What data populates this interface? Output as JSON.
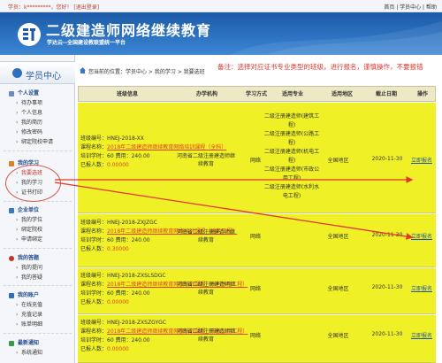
{
  "topbar": {
    "student_prefix": "学员：",
    "student_name": "k*********，您好！",
    "logout": "[退出登录]",
    "links": "首页 | 学员中心 | 帮助"
  },
  "banner": {
    "title": "二级建造师网络继续教育",
    "subtitle": "学达云--全国建设教联盟统一平台"
  },
  "sidebar": {
    "header": "学员中心",
    "groups": [
      {
        "title": "个人设置",
        "items": [
          "待办事项",
          "个人信息",
          "我的简历",
          "修改密码",
          "绑定院校申请"
        ]
      },
      {
        "title": "我的学习",
        "items": [
          "我要选班",
          "我的学习",
          "证书打印"
        ]
      },
      {
        "title": "企业单位",
        "items": [
          "我的学位",
          "绑定院校",
          "申请绑定"
        ]
      },
      {
        "title": "我的答题",
        "items": [
          "我的提问",
          "我的答疑"
        ]
      },
      {
        "title": "我的账户",
        "items": [
          "在线充值",
          "充值记录",
          "账单明细"
        ]
      },
      {
        "title": "最新通知",
        "items": [
          "系统通知"
        ]
      }
    ]
  },
  "breadcrumb": {
    "text": "您当前的位置：学员中心 > 我的学习 > 我要选班"
  },
  "note": "备注：选择对应证书专业类型的班级，进行报名，谨慎操作，不要报错",
  "table": {
    "headers": [
      "班级信息",
      "办学机构",
      "学习方式",
      "适用专业",
      "适用地区",
      "截止日期",
      "操作"
    ],
    "label_class_no": "班级编号：",
    "label_course": "课程名称：",
    "label_hours": "培训学时：",
    "label_fee": "费用：",
    "label_enrolled": "已报人数：",
    "rows": [
      {
        "class_no": "HNEJ-2018-XX",
        "course": "2018年二级建造师继续教育网络培训课程（全科）",
        "hours": "60",
        "fee": "240.00",
        "enrolled": "0.00000",
        "org": "河南省二级注册建造师继续教育",
        "way": "网络",
        "majors": [
          "二级注册建造师(建筑工程)",
          "二级注册建造师(公路工程)",
          "二级注册建造师(机电工程)",
          "二级注册建造师(市政公用工程)",
          "二级注册建造师(水利水电工程)"
        ],
        "region": "全国地区",
        "deadline": "2020-11-30",
        "action": "立即报名"
      },
      {
        "class_no": "HNEJ-2018-ZXJZGC",
        "course": "2018年二级建造师继续教育网络培训课程（建筑工程）",
        "hours": "60",
        "fee": "240.00",
        "enrolled": "0.30000",
        "org": "河南省二级注册建造师继续教育",
        "way": "网络",
        "majors": [],
        "region": "全国地区",
        "deadline": "2020-11-30",
        "action": "立即报名"
      },
      {
        "class_no": "HNEJ-2018-ZXSLSDGC",
        "course": "2018年二级建造师继续教育网络培训课程（水利水电工程）",
        "hours": "60",
        "fee": "240.00",
        "enrolled": "0.00000",
        "org": "河南省二级注册建造师继续教育",
        "way": "网络",
        "majors": [],
        "region": "全国地区",
        "deadline": "2020-11-30",
        "action": "立即报名"
      },
      {
        "class_no": "HNEJ-2018-ZXSZGYGC",
        "course": "2018年二级建造师继续教育网络培训课程（市政公用工程）",
        "hours": "60",
        "fee": "240.00",
        "enrolled": "0.00000",
        "org": "河南省二级注册建造师继续教育",
        "way": "网络",
        "majors": [],
        "region": "全国地区",
        "deadline": "2020-11-30",
        "action": "立即报名"
      }
    ]
  },
  "colors": {
    "banner": "#2c72c1",
    "row_highlight": "#eff126",
    "annotation": "#e3352c",
    "link": "#2457a7"
  }
}
